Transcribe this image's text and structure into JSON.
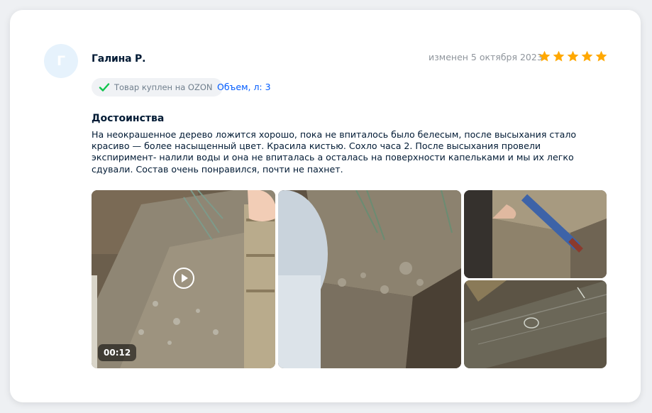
{
  "review": {
    "avatar_letter": "Г",
    "author": "Галина Р.",
    "date": "изменен 5 октября 2023",
    "rating": 5,
    "star_color": "#ffa800",
    "badge_label": "Товар куплен на OZON",
    "badge_icon": "check-icon",
    "badge_icon_color": "#10c44c",
    "volume": "Объем, л: 3",
    "section_title": "Достоинства",
    "text": "На неокрашенное дерево ложится хорошо, пока не впиталось было белесым, после высыхания стало красиво — более насыщенный цвет. Красила кистью. Сохло часа 2. После высыхания провели экспиримент- налили воды и она не впиталась а осталась на поверхности капельками и мы их легко сдували. Состав очень понравился, почти не пахнет."
  },
  "media": {
    "video_duration": "00:12",
    "play_icon": "play-icon",
    "items": [
      "video",
      "photo",
      "photo",
      "photo"
    ]
  }
}
